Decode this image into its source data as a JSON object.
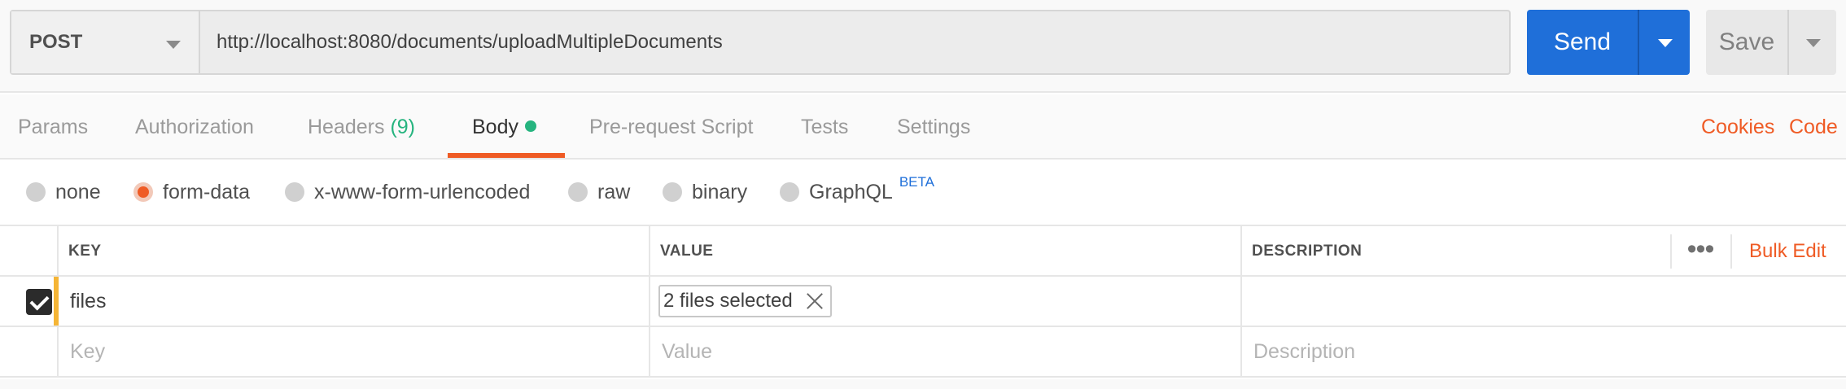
{
  "request": {
    "method": "POST",
    "url": "http://localhost:8080/documents/uploadMultipleDocuments",
    "send_label": "Send",
    "save_label": "Save"
  },
  "tabs": {
    "params": "Params",
    "authorization": "Authorization",
    "headers": "Headers",
    "headers_count": "(9)",
    "body": "Body",
    "prerequest": "Pre-request Script",
    "tests": "Tests",
    "settings": "Settings",
    "active": "Body"
  },
  "links": {
    "cookies": "Cookies",
    "code": "Code"
  },
  "body_types": {
    "selected": "form-data",
    "none": "none",
    "form_data": "form-data",
    "urlencoded": "x-www-form-urlencoded",
    "raw": "raw",
    "binary": "binary",
    "graphql": "GraphQL",
    "beta": "BETA"
  },
  "table": {
    "headers": {
      "key": "KEY",
      "value": "VALUE",
      "description": "DESCRIPTION",
      "more": "•••",
      "bulk_edit": "Bulk Edit"
    },
    "rows": [
      {
        "checked": true,
        "key": "files",
        "value": "2 files selected",
        "description": ""
      }
    ],
    "placeholders": {
      "key": "Key",
      "value": "Value",
      "description": "Description"
    }
  },
  "colors": {
    "accent": "#ef5b25",
    "send": "#1f6fd9",
    "success": "#26b47f",
    "dirty": "#f5b536"
  },
  "icons": {
    "method_caret": "chevron-down-icon",
    "send_caret": "chevron-down-icon",
    "save_caret": "chevron-down-icon",
    "checkbox": "checkmark-icon",
    "remove_file": "close-icon",
    "more": "more-horizontal-icon"
  }
}
